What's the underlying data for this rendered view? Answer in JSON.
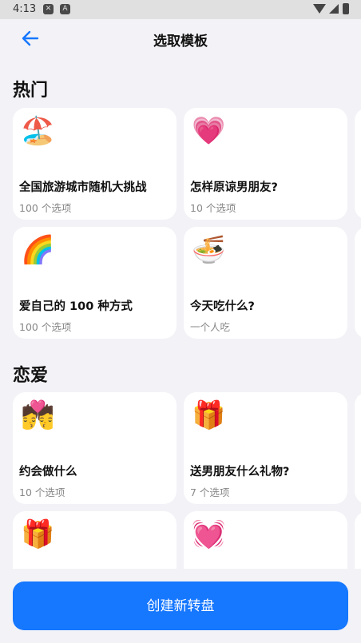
{
  "status": {
    "time": "4:13"
  },
  "header": {
    "title": "选取模板"
  },
  "sections": [
    {
      "title": "热门",
      "cards": [
        {
          "emoji": "🏖️",
          "emoji_name": "beach-umbrella-icon",
          "name": "全国旅游城市随机大挑战",
          "sub": "100 个选项"
        },
        {
          "emoji": "💗",
          "emoji_name": "heart-icon",
          "name": "怎样原谅男朋友?",
          "sub": "10 个选项"
        },
        {
          "emoji": "🌈",
          "emoji_name": "rainbow-icon",
          "name": "爱自己的 100 种方式",
          "sub": "100 个选项"
        },
        {
          "emoji": "🍜",
          "emoji_name": "noodle-bowl-icon",
          "name": "今天吃什么?",
          "sub": "一个人吃"
        }
      ]
    },
    {
      "title": "恋爱",
      "cards": [
        {
          "emoji": "💏",
          "emoji_name": "kiss-couple-icon",
          "name": "约会做什么",
          "sub": "10 个选项"
        },
        {
          "emoji": "🎁",
          "emoji_name": "gift-icon",
          "name": "送男朋友什么礼物?",
          "sub": "7 个选项"
        },
        {
          "emoji": "🎁",
          "emoji_name": "gift-icon",
          "name": "",
          "sub": ""
        },
        {
          "emoji": "💓",
          "emoji_name": "beating-heart-icon",
          "name": "",
          "sub": ""
        }
      ]
    }
  ],
  "footer": {
    "button_label": "创建新转盘"
  },
  "colors": {
    "accent": "#1677ff",
    "background": "#f2f2f7",
    "card": "#ffffff"
  }
}
